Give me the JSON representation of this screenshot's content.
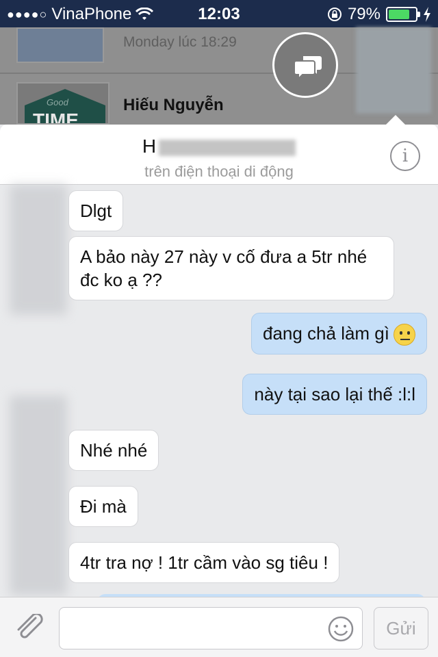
{
  "status_bar": {
    "carrier": "VinaPhone",
    "time": "12:03",
    "battery": "79%",
    "battery_level": 0.79
  },
  "background": {
    "item1_time": "Monday lúc 18:29",
    "item2_name": "Hiếu Nguyễn",
    "item2_thumb_small": "Good",
    "item2_thumb_big": "TIME"
  },
  "header": {
    "contact_name": "H",
    "status": "trên điện thoại di động",
    "info_label": "i"
  },
  "messages": [
    {
      "direction": "in",
      "text": "Dlgt"
    },
    {
      "direction": "in",
      "text": "A bảo này 27 này v cố đưa a 5tr nhé đc ko ạ ??"
    },
    {
      "direction": "out",
      "text": "đang chả làm gì"
    },
    {
      "direction": "out",
      "text": "này tại sao lại thế :l:l"
    },
    {
      "direction": "in",
      "text": "Nhé nhé"
    },
    {
      "direction": "in",
      "text": "Đi mà"
    },
    {
      "direction": "in",
      "text": "4tr tra nợ ! 1tr cầm vào sg tiêu !"
    }
  ],
  "composer": {
    "input_value": "",
    "send_label": "Gửi"
  },
  "colors": {
    "status_bar_bg": "#1c2c4c",
    "outgoing_bubble": "#c6dff8",
    "incoming_bubble": "#ffffff",
    "battery_green": "#4cd964"
  }
}
